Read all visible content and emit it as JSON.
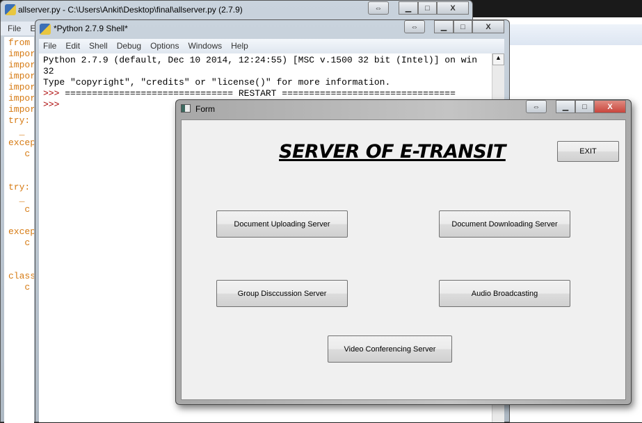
{
  "editor": {
    "title": "allserver.py - C:\\Users\\Ankit\\Desktop\\final\\allserver.py (2.7.9)",
    "menu": [
      "File",
      "E"
    ],
    "code_lines": [
      "from",
      "impor",
      "impor",
      "impor",
      "impor",
      "impor",
      "impor",
      "try:",
      "  _",
      "excep",
      "   c",
      "",
      "",
      "try:",
      "  _",
      "   c",
      "",
      "excep",
      "   c",
      "",
      "",
      "class",
      "   c"
    ]
  },
  "shell": {
    "title": "*Python 2.7.9 Shell*",
    "menu": [
      "File",
      "Edit",
      "Shell",
      "Debug",
      "Options",
      "Windows",
      "Help"
    ],
    "lines": [
      "Python 2.7.9 (default, Dec 10 2014, 12:24:55) [MSC v.1500 32 bit (Intel)] on win",
      "32",
      "Type \"copyright\", \"credits\" or \"license()\" for more information."
    ],
    "restart_prompt": ">>> ",
    "restart_line": "=============================== RESTART ================================",
    "prompt": ">>>"
  },
  "form": {
    "title": "Form",
    "heading": "SERVER OF E-TRANSIT",
    "exit": "EXIT",
    "buttons": {
      "upload": "Document Uploading Server",
      "download": "Document Downloading Server",
      "group": "Group Disccussion Server",
      "audio": "Audio Broadcasting",
      "video": "Video Conferencing Server"
    }
  },
  "icons": {
    "resize": "⇔",
    "minimize": "▁",
    "maximize": "□",
    "close": "X"
  },
  "colors": {
    "close_red": "#c9463d",
    "code_orange": "#d67a12",
    "prompt_red": "#a00000"
  }
}
